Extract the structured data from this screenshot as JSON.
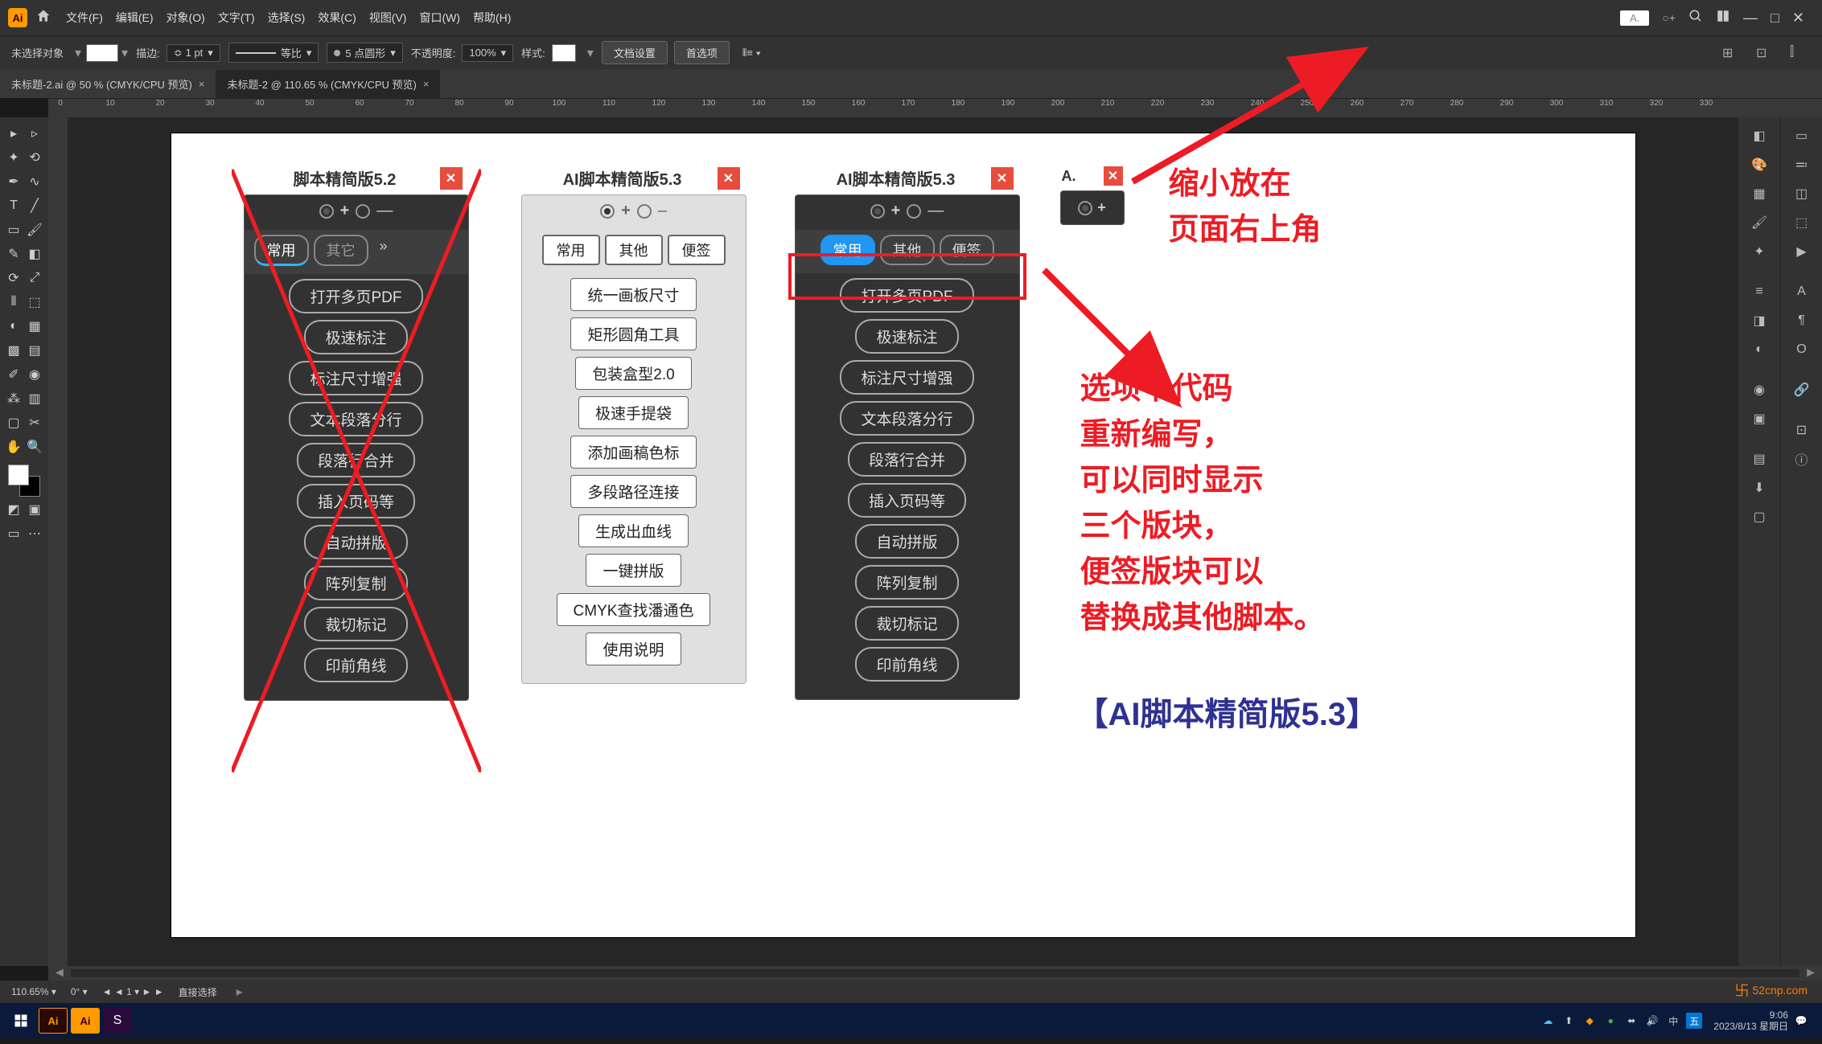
{
  "menubar": {
    "logo": "Ai",
    "items": [
      "文件(F)",
      "编辑(E)",
      "对象(O)",
      "文字(T)",
      "选择(S)",
      "效果(C)",
      "视图(V)",
      "窗口(W)",
      "帮助(H)"
    ],
    "docked_text": "A.",
    "search_addon": "○+"
  },
  "options": {
    "no_selection": "未选择对象",
    "stroke_label": "描边:",
    "stroke_value": "1 pt",
    "uniform": "等比",
    "points_round": "5 点圆形",
    "opacity_label": "不透明度:",
    "opacity_value": "100%",
    "style_label": "样式:",
    "doc_setup": "文档设置",
    "prefs": "首选项"
  },
  "tabs": [
    {
      "label": "未标题-2.ai @ 50 % (CMYK/CPU 预览)",
      "active": false
    },
    {
      "label": "未标题-2 @ 110.65 % (CMYK/CPU 预览)",
      "active": true
    }
  ],
  "panels": {
    "p1": {
      "title": "脚本精简版5.2",
      "tabs": [
        "常用",
        "其它"
      ],
      "buttons": [
        "打开多页PDF",
        "极速标注",
        "标注尺寸增强",
        "文本段落分行",
        "段落行合并",
        "插入页码等",
        "自动拼版",
        "阵列复制",
        "裁切标记",
        "印前角线"
      ]
    },
    "p2": {
      "title": "AI脚本精简版5.3",
      "tabs": [
        "常用",
        "其他",
        "便签"
      ],
      "buttons": [
        "统一画板尺寸",
        "矩形圆角工具",
        "包装盒型2.0",
        "极速手提袋",
        "添加画稿色标",
        "多段路径连接",
        "生成出血线",
        "一键拼版",
        "CMYK查找潘通色",
        "使用说明"
      ]
    },
    "p3": {
      "title": "AI脚本精简版5.3",
      "tabs": [
        "常用",
        "其他",
        "便签"
      ],
      "buttons": [
        "打开多页PDF",
        "极速标注",
        "标注尺寸增强",
        "文本段落分行",
        "段落行合并",
        "插入页码等",
        "自动拼版",
        "阵列复制",
        "裁切标记",
        "印前角线"
      ]
    },
    "p4": {
      "title": "A."
    }
  },
  "anno": {
    "t1_l1": "缩小放在",
    "t1_l2": "页面右上角",
    "t2_l1": "选项卡代码",
    "t2_l2": "重新编写，",
    "t2_l3": "可以同时显示",
    "t2_l4": "三个版块，",
    "t2_l5": "便签版块可以",
    "t2_l6": "替换成其他脚本。",
    "blue": "【AI脚本精简版5.3】"
  },
  "status": {
    "zoom": "110.65%",
    "rot": "0°",
    "page": "1",
    "tool": "直接选择"
  },
  "taskbar": {
    "time": "9:06",
    "date": "2023/8/13 星期日"
  },
  "watermark": "52cnp.com",
  "ruler": [
    0,
    10,
    20,
    30,
    40,
    50,
    60,
    70,
    80,
    90,
    100,
    110,
    120,
    130,
    140,
    150,
    160,
    170,
    180,
    190,
    200,
    210,
    220,
    230,
    240,
    250,
    260,
    270,
    280,
    290,
    300,
    310,
    320,
    330
  ]
}
